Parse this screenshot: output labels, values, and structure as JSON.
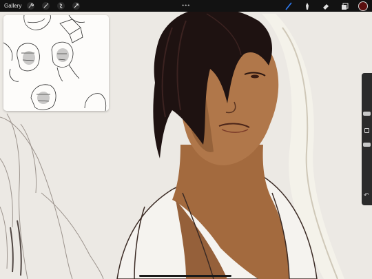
{
  "toolbar": {
    "gallery_label": "Gallery",
    "left_tools": [
      "wrench-icon",
      "magic-wand-icon",
      "selection-icon",
      "transform-icon"
    ],
    "more_dots": "•••",
    "right_tools": [
      "brush-icon",
      "smudge-icon",
      "eraser-icon",
      "layers-icon"
    ],
    "current_color": "#5a0f0f",
    "active_tool_color": "#2f7df6"
  },
  "sidebar": {
    "brush_size_level": 0.3,
    "opacity_level": 0.55,
    "undo_glyph": "↶"
  },
  "reference": {
    "background": "#fdfcfa"
  }
}
